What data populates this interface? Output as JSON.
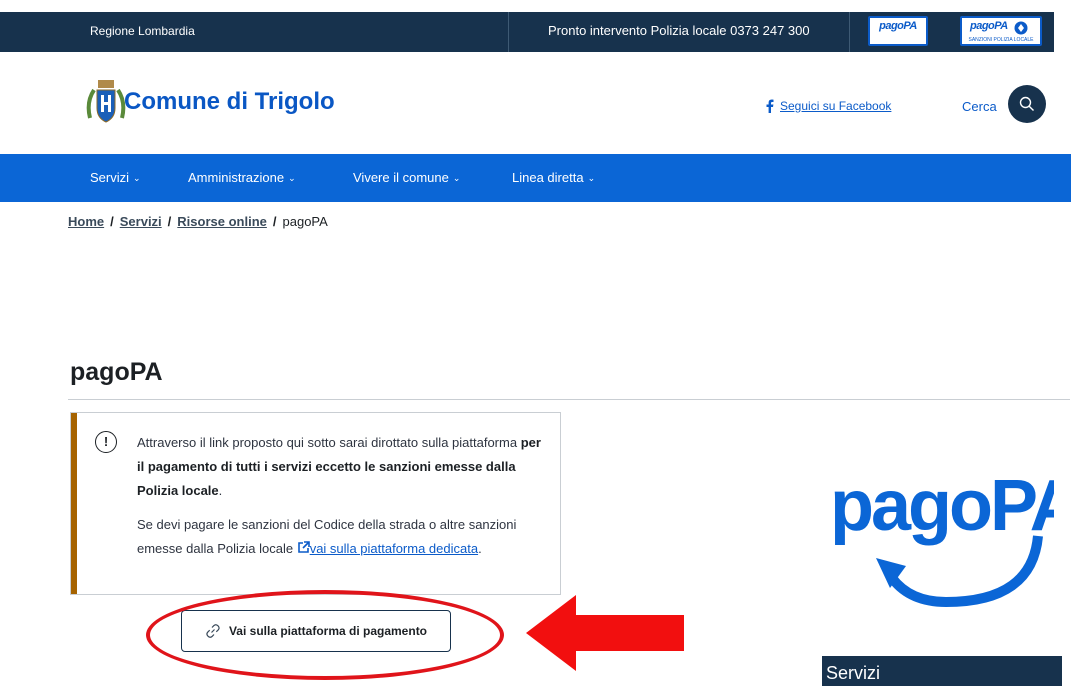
{
  "topbar": {
    "region": "Regione Lombardia",
    "emergency": "Pronto intervento Polizia locale 0373 247 300",
    "badge1": "pagoPA",
    "badge2": "pagoPA",
    "badge2_sub": "SANZIONI POLIZIA LOCALE"
  },
  "header": {
    "title": "Comune di Trigolo",
    "facebook": "Seguici su Facebook",
    "search_label": "Cerca"
  },
  "nav": {
    "items": [
      {
        "label": "Servizi"
      },
      {
        "label": "Amministrazione"
      },
      {
        "label": "Vivere il comune"
      },
      {
        "label": "Linea diretta"
      }
    ]
  },
  "breadcrumb": {
    "home": "Home",
    "servizi": "Servizi",
    "risorse": "Risorse online",
    "current": "pagoPA",
    "separator": "/"
  },
  "page": {
    "title": "pagoPA"
  },
  "callout": {
    "icon": "!",
    "p1_text": "Attraverso il link proposto qui sotto sarai dirottato sulla piattaforma ",
    "p1_bold": "per il pagamento di tutti i servizi eccetto le sanzioni emesse dalla Polizia locale",
    "p1_end": ".",
    "p2_text": "Se devi pagare le sanzioni del Codice della strada o altre sanzioni emesse dalla Polizia locale ",
    "p2_link": "vai sulla piattaforma dedicata",
    "p2_end": "."
  },
  "button": {
    "label": "Vai sulla piattaforma di pagamento"
  },
  "sidebar": {
    "logo_text": "pagoPA",
    "servizi": "Servizi"
  },
  "colors": {
    "dark_blue": "#17324d",
    "primary_blue": "#0b66d6",
    "link_blue": "#0b5bc9",
    "callout_accent": "#a66300",
    "annotation_red": "#e0141a"
  },
  "icons": [
    "crest-icon",
    "facebook-icon",
    "search-icon",
    "info-icon",
    "external-link-icon",
    "link-icon",
    "chevron-down-icon"
  ]
}
